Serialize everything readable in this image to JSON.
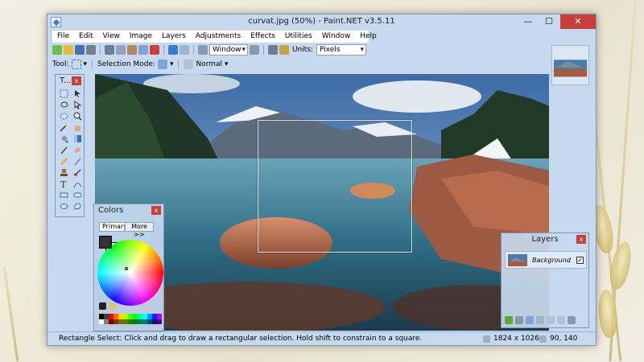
{
  "window": {
    "title": "curvat.jpg (50%) - Paint.NET v3.5.11",
    "min_label": "—",
    "max_label": "☐",
    "close_label": "✕"
  },
  "menu": [
    "File",
    "Edit",
    "View",
    "Image",
    "Layers",
    "Adjustments",
    "Effects",
    "Utilities",
    "Window",
    "Help"
  ],
  "toolbar": {
    "zoom_value": "Window",
    "units_label": "Units:",
    "units_value": "Pixels",
    "tool_label": "Tool:",
    "selection_mode_label": "Selection Mode:",
    "blend_mode": "Normal"
  },
  "tools_panel": {
    "title": "T...",
    "close": "x"
  },
  "colors_panel": {
    "title": "Colors",
    "close": "x",
    "mode": "Primary",
    "more_button": "More >>"
  },
  "layers_panel": {
    "title": "Layers",
    "close": "x",
    "layer_name": "Background",
    "layer_visible": "✓"
  },
  "status": {
    "help_text": "Rectangle Select: Click and drag to draw a rectangular selection. Hold shift to constrain to a square.",
    "image_size": "1824 x 1026",
    "cursor_pos": "90, 140"
  }
}
